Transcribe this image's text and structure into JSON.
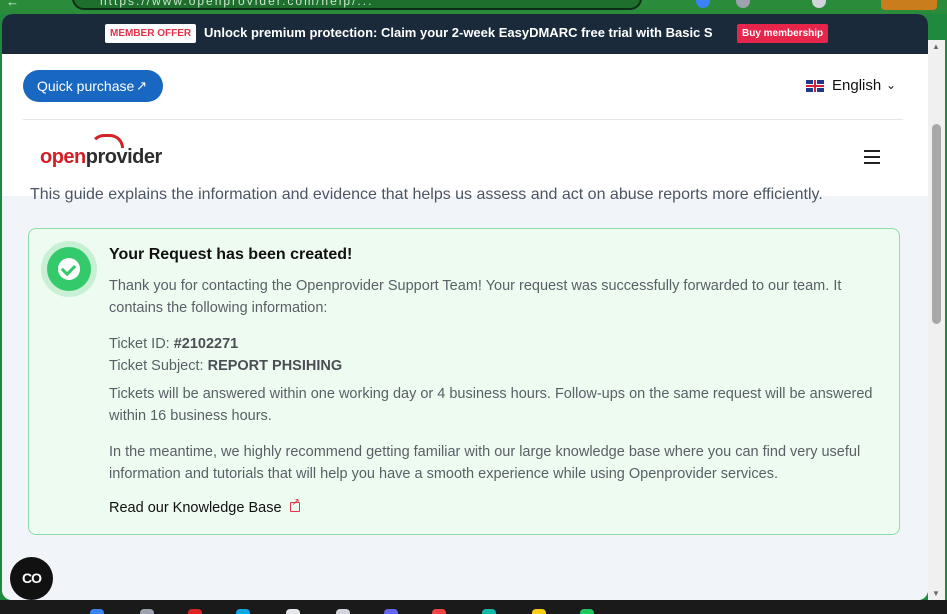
{
  "browser": {
    "url": "https://www.openprovider.com/help/...",
    "back_glyph": "←"
  },
  "promo": {
    "badge": "MEMBER OFFER",
    "text": "Unlock premium protection: Claim your 2-week EasyDMARC free trial with Basic S",
    "button": "Buy membership"
  },
  "header": {
    "quick_purchase": "Quick purchase",
    "quick_purchase_icon": "↗",
    "language": "English",
    "language_icon": "chevron-down",
    "logo_open": "open",
    "logo_provider": "provider"
  },
  "guide_text": "This guide explains the information and evidence that helps us assess and act on abuse reports more efficiently.",
  "success": {
    "title": "Your Request has been created!",
    "intro": "Thank you for contacting the Openprovider Support Team! Your request was successfully forwarded to our team. It contains the following information:",
    "ticket_id_label": "Ticket ID: ",
    "ticket_id_value": "#2102271",
    "ticket_subject_label": "Ticket Subject: ",
    "ticket_subject_value": "REPORT PHSIHING",
    "response_time": "Tickets will be answered within one working day or 4 business hours. Follow-ups on the same request will be answered within 16 business hours.",
    "knowledge_note": "In the meantime, we highly recommend getting familiar with our large knowledge base where you can find very useful information and tutorials that will help you have a smooth experience while using Openprovider services.",
    "kb_link": "Read our Knowledge Base"
  },
  "chat": {
    "label": "CO"
  },
  "colors": {
    "promo_bg": "#1b2a3b",
    "quick_purchase_bg": "#1867c0",
    "success_bg": "#eefbf1",
    "success_border": "#8fdca6",
    "check_green": "#34c96b",
    "brand_red": "#d32027",
    "buy_button": "#e6254a"
  }
}
